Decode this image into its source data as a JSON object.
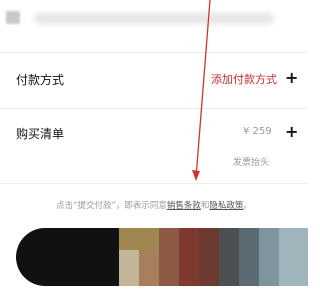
{
  "sections": {
    "payment": {
      "label": "付款方式",
      "action": "添加付款方式"
    },
    "cart": {
      "label": "购买清单",
      "price": "¥ 259",
      "invoice": "发票抬头"
    }
  },
  "notice": {
    "prefix": "点击“提交付款”，即表示同意",
    "terms": "销售条款",
    "and": "和",
    "privacy": "隐私政策",
    "suffix": "。"
  },
  "icons": {
    "plus": "+"
  },
  "colors": {
    "accent": "#c0312d",
    "button": "#111111",
    "muted": "#9a9a9a"
  }
}
